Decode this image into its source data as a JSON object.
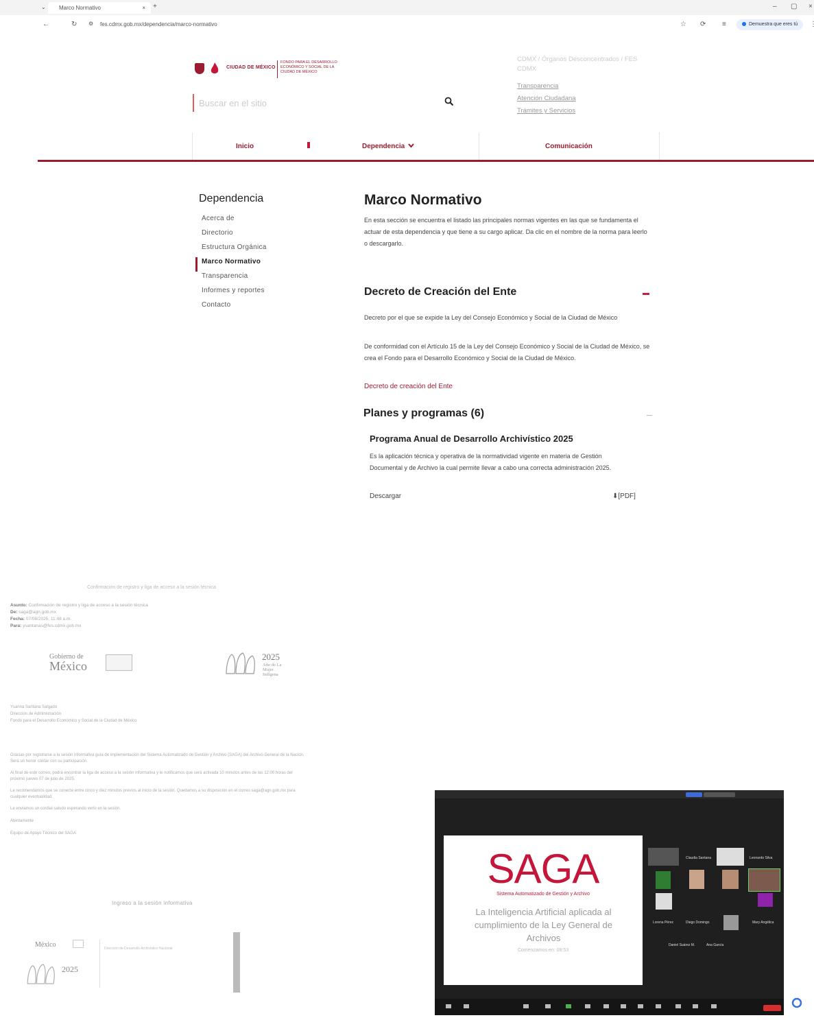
{
  "browser": {
    "tab_title": "Marco Normativo",
    "url": "fes.cdmx.gob.mx/dependencia/marco-normativo",
    "signin_label": "Demuestra que eres tú"
  },
  "header": {
    "logo_cdmx": "CIUDAD DE MÉXICO",
    "logo_fes": "FONDO PARA EL DESARROLLO ECONÓMICO Y SOCIAL DE LA CIUDAD DE MÉXICO",
    "search_placeholder": "Buscar en el sitio",
    "breadcrumb": "CDMX / Órganos Desconcentrados / FES CDMX",
    "top_links": [
      "Transparencia",
      "Atención Ciudadana",
      "Trámites y Servicios"
    ]
  },
  "nav": {
    "items": [
      "Inicio",
      "Dependencia",
      "Comunicación"
    ]
  },
  "sidebar": {
    "title": "Dependencia",
    "items": [
      {
        "label": "Acerca de",
        "active": false
      },
      {
        "label": "Directorio",
        "active": false
      },
      {
        "label": "Estructura Orgánica",
        "active": false
      },
      {
        "label": "Marco Normativo",
        "active": true
      },
      {
        "label": "Transparencia",
        "active": false
      },
      {
        "label": "Informes y reportes",
        "active": false
      },
      {
        "label": "Contacto",
        "active": false
      }
    ]
  },
  "main": {
    "title": "Marco Normativo",
    "intro": "En esta sección se encuentra el listado las principales normas vigentes en las que se fundamenta el actuar de esta dependencia y que tiene a su cargo aplicar. Da clic en el nombre de la norma para leerlo o descargarlo.",
    "section1": {
      "title": "Decreto de Creación del Ente",
      "p1": "Decreto por el que se expide la Ley del Consejo Económico y Social de la Ciudad de México",
      "p2": "De conformidad con el Artículo 15 de la Ley del Consejo Económico y Social de la Ciudad de México, se crea el Fondo para el Desarrollo Económico y Social de la Ciudad de México.",
      "link": "Decreto de creación del Ente"
    },
    "section2": {
      "title": "Planes y programas (6)",
      "program_title": "Programa Anual de Desarrollo Archivístico 2025",
      "program_desc": "Es la aplicación técnica y operativa de la normatividad vigente en materia de Gestión Documental y de Archivo la cual permite llevar a cabo una correcta administración 2025.",
      "download_label": "Descargar",
      "format_label": "[PDF]"
    }
  },
  "email": {
    "subject_header": "Confirmación de registro y liga de acceso a la sesión técnica",
    "fields": [
      {
        "k": "Asunto:",
        "v": "Confirmación de registro y liga de acceso a la sesión técnica"
      },
      {
        "k": "De:",
        "v": "saga@agn.gob.mx"
      },
      {
        "k": "Fecha:",
        "v": "07/08/2025, 11:48 a.m."
      },
      {
        "k": "Para:",
        "v": "ysantanas@fes.cdmx.gob.mx"
      }
    ],
    "gob_small": "Gobierno de",
    "gob_big": "México",
    "year": "2025",
    "year_sub": "Año de La Mujer Indígena",
    "recipient": [
      "Ysanna Santana Salgado",
      "Dirección de Administración",
      "Fondo para el Desarrollo Económico y Social de la Ciudad de México"
    ],
    "body": [
      "Gracias por registrarse a la sesión informativa guía de implementación del Sistema Automatizado de Gestión y Archivo (SAGA) del Archivo General de la Nación. Será un honor contar con su participación.",
      "Al final de este correo, podrá encontrar la liga de acceso a la sesión informativa y le notificamos que será activada 10 minutos antes de las 12:00 horas del próximo jueves 07 de julio de 2025.",
      "Le recomendamos que se conecte entre cinco y diez minutos previos al inicio de la sesión. Quedamos a su disposición en el correo saga@agn.gob.mx para cualquier eventualidad.",
      "Le enviamos un cordial saludo esperando verlo en la sesión.",
      "Atentamente",
      "Equipo de Apoyo Técnico del SAGA"
    ],
    "ingreso": "Ingreso a la sesión informativa",
    "footer_org": "Dirección de Desarrollo Archivístico Nacional"
  },
  "call": {
    "slide_title": "SAGA",
    "slide_sub": "Sistema Automatizado de Gestión y Archivo",
    "slide_text": "La Inteligencia Artificial aplicada al cumplimiento de la Ley General de Archivos",
    "slide_time": "Comenzamos en: 08:53",
    "participants": [
      "Claudia Santana",
      "Leonardo Silva",
      "Lorena Pérez",
      "Diego Domingo",
      "Mary Angélica",
      "Daniel Suárez M.",
      "Ana García"
    ]
  },
  "colors": {
    "brand": "#9b1c31",
    "accent": "#c4153a"
  }
}
